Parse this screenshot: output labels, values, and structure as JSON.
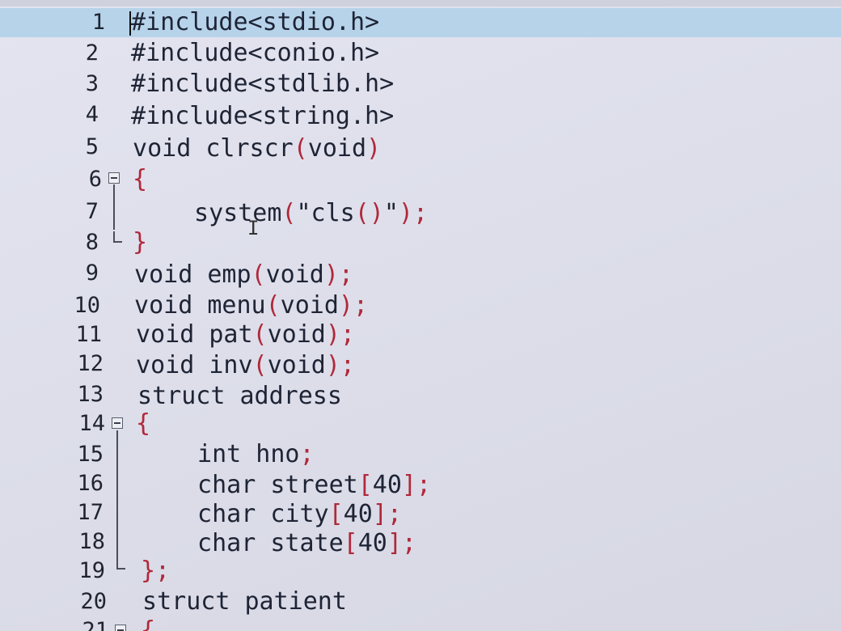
{
  "editor": {
    "lines": [
      {
        "num": "1",
        "code": "#include<stdio.h>"
      },
      {
        "num": "2",
        "code": "#include<conio.h>"
      },
      {
        "num": "3",
        "code": "#include<stdlib.h>"
      },
      {
        "num": "4",
        "code": "#include<string.h>"
      },
      {
        "num": "5",
        "code": "void clrscr(void)"
      },
      {
        "num": "6",
        "code": "{"
      },
      {
        "num": "7",
        "code": "system(\"cls()\");"
      },
      {
        "num": "8",
        "code": "}"
      },
      {
        "num": "9",
        "code": "void emp(void);"
      },
      {
        "num": "10",
        "code": "void menu(void);"
      },
      {
        "num": "11",
        "code": "void pat(void);"
      },
      {
        "num": "12",
        "code": "void inv(void);"
      },
      {
        "num": "13",
        "code": "struct address"
      },
      {
        "num": "14",
        "code": "{"
      },
      {
        "num": "15",
        "code": "int hno;"
      },
      {
        "num": "16",
        "code": "char street[40];"
      },
      {
        "num": "17",
        "code": "char city[40];"
      },
      {
        "num": "18",
        "code": "char state[40];"
      },
      {
        "num": "19",
        "code": "};"
      },
      {
        "num": "20",
        "code": "struct patient"
      },
      {
        "num": "21",
        "code": "{"
      }
    ],
    "current_line": "1"
  },
  "colors": {
    "highlight": "#b6d3ea",
    "punctuation": "#b0283a",
    "text": "#1e2435",
    "background": "#dcdde9"
  },
  "icons": [
    "fold-collapse-icon",
    "text-cursor-icon"
  ]
}
